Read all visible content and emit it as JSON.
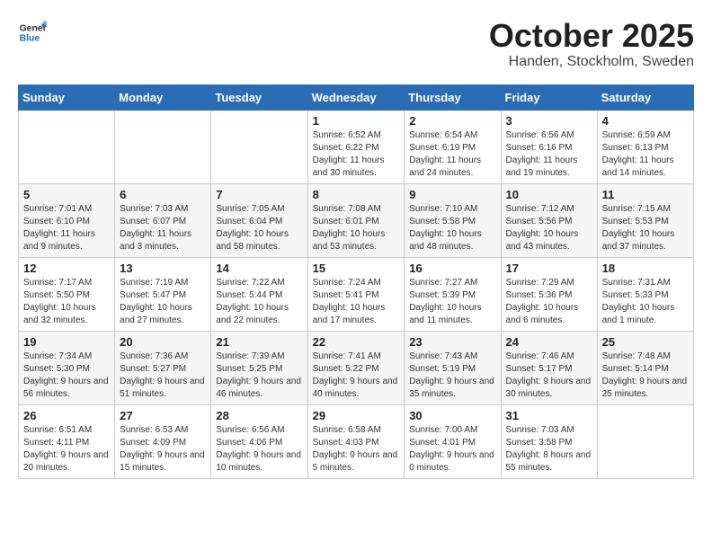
{
  "header": {
    "logo_general": "General",
    "logo_blue": "Blue",
    "month": "October 2025",
    "location": "Handen, Stockholm, Sweden"
  },
  "weekdays": [
    "Sunday",
    "Monday",
    "Tuesday",
    "Wednesday",
    "Thursday",
    "Friday",
    "Saturday"
  ],
  "weeks": [
    [
      {
        "day": "",
        "content": ""
      },
      {
        "day": "",
        "content": ""
      },
      {
        "day": "",
        "content": ""
      },
      {
        "day": "1",
        "content": "Sunrise: 6:52 AM\nSunset: 6:22 PM\nDaylight: 11 hours\nand 30 minutes."
      },
      {
        "day": "2",
        "content": "Sunrise: 6:54 AM\nSunset: 6:19 PM\nDaylight: 11 hours\nand 24 minutes."
      },
      {
        "day": "3",
        "content": "Sunrise: 6:56 AM\nSunset: 6:16 PM\nDaylight: 11 hours\nand 19 minutes."
      },
      {
        "day": "4",
        "content": "Sunrise: 6:59 AM\nSunset: 6:13 PM\nDaylight: 11 hours\nand 14 minutes."
      }
    ],
    [
      {
        "day": "5",
        "content": "Sunrise: 7:01 AM\nSunset: 6:10 PM\nDaylight: 11 hours\nand 9 minutes."
      },
      {
        "day": "6",
        "content": "Sunrise: 7:03 AM\nSunset: 6:07 PM\nDaylight: 11 hours\nand 3 minutes."
      },
      {
        "day": "7",
        "content": "Sunrise: 7:05 AM\nSunset: 6:04 PM\nDaylight: 10 hours\nand 58 minutes."
      },
      {
        "day": "8",
        "content": "Sunrise: 7:08 AM\nSunset: 6:01 PM\nDaylight: 10 hours\nand 53 minutes."
      },
      {
        "day": "9",
        "content": "Sunrise: 7:10 AM\nSunset: 5:58 PM\nDaylight: 10 hours\nand 48 minutes."
      },
      {
        "day": "10",
        "content": "Sunrise: 7:12 AM\nSunset: 5:56 PM\nDaylight: 10 hours\nand 43 minutes."
      },
      {
        "day": "11",
        "content": "Sunrise: 7:15 AM\nSunset: 5:53 PM\nDaylight: 10 hours\nand 37 minutes."
      }
    ],
    [
      {
        "day": "12",
        "content": "Sunrise: 7:17 AM\nSunset: 5:50 PM\nDaylight: 10 hours\nand 32 minutes."
      },
      {
        "day": "13",
        "content": "Sunrise: 7:19 AM\nSunset: 5:47 PM\nDaylight: 10 hours\nand 27 minutes."
      },
      {
        "day": "14",
        "content": "Sunrise: 7:22 AM\nSunset: 5:44 PM\nDaylight: 10 hours\nand 22 minutes."
      },
      {
        "day": "15",
        "content": "Sunrise: 7:24 AM\nSunset: 5:41 PM\nDaylight: 10 hours\nand 17 minutes."
      },
      {
        "day": "16",
        "content": "Sunrise: 7:27 AM\nSunset: 5:39 PM\nDaylight: 10 hours\nand 11 minutes."
      },
      {
        "day": "17",
        "content": "Sunrise: 7:29 AM\nSunset: 5:36 PM\nDaylight: 10 hours\nand 6 minutes."
      },
      {
        "day": "18",
        "content": "Sunrise: 7:31 AM\nSunset: 5:33 PM\nDaylight: 10 hours\nand 1 minute."
      }
    ],
    [
      {
        "day": "19",
        "content": "Sunrise: 7:34 AM\nSunset: 5:30 PM\nDaylight: 9 hours\nand 56 minutes."
      },
      {
        "day": "20",
        "content": "Sunrise: 7:36 AM\nSunset: 5:27 PM\nDaylight: 9 hours\nand 51 minutes."
      },
      {
        "day": "21",
        "content": "Sunrise: 7:39 AM\nSunset: 5:25 PM\nDaylight: 9 hours\nand 46 minutes."
      },
      {
        "day": "22",
        "content": "Sunrise: 7:41 AM\nSunset: 5:22 PM\nDaylight: 9 hours\nand 40 minutes."
      },
      {
        "day": "23",
        "content": "Sunrise: 7:43 AM\nSunset: 5:19 PM\nDaylight: 9 hours\nand 35 minutes."
      },
      {
        "day": "24",
        "content": "Sunrise: 7:46 AM\nSunset: 5:17 PM\nDaylight: 9 hours\nand 30 minutes."
      },
      {
        "day": "25",
        "content": "Sunrise: 7:48 AM\nSunset: 5:14 PM\nDaylight: 9 hours\nand 25 minutes."
      }
    ],
    [
      {
        "day": "26",
        "content": "Sunrise: 6:51 AM\nSunset: 4:11 PM\nDaylight: 9 hours\nand 20 minutes."
      },
      {
        "day": "27",
        "content": "Sunrise: 6:53 AM\nSunset: 4:09 PM\nDaylight: 9 hours\nand 15 minutes."
      },
      {
        "day": "28",
        "content": "Sunrise: 6:56 AM\nSunset: 4:06 PM\nDaylight: 9 hours\nand 10 minutes."
      },
      {
        "day": "29",
        "content": "Sunrise: 6:58 AM\nSunset: 4:03 PM\nDaylight: 9 hours\nand 5 minutes."
      },
      {
        "day": "30",
        "content": "Sunrise: 7:00 AM\nSunset: 4:01 PM\nDaylight: 9 hours\nand 0 minutes."
      },
      {
        "day": "31",
        "content": "Sunrise: 7:03 AM\nSunset: 3:58 PM\nDaylight: 8 hours\nand 55 minutes."
      },
      {
        "day": "",
        "content": ""
      }
    ]
  ]
}
